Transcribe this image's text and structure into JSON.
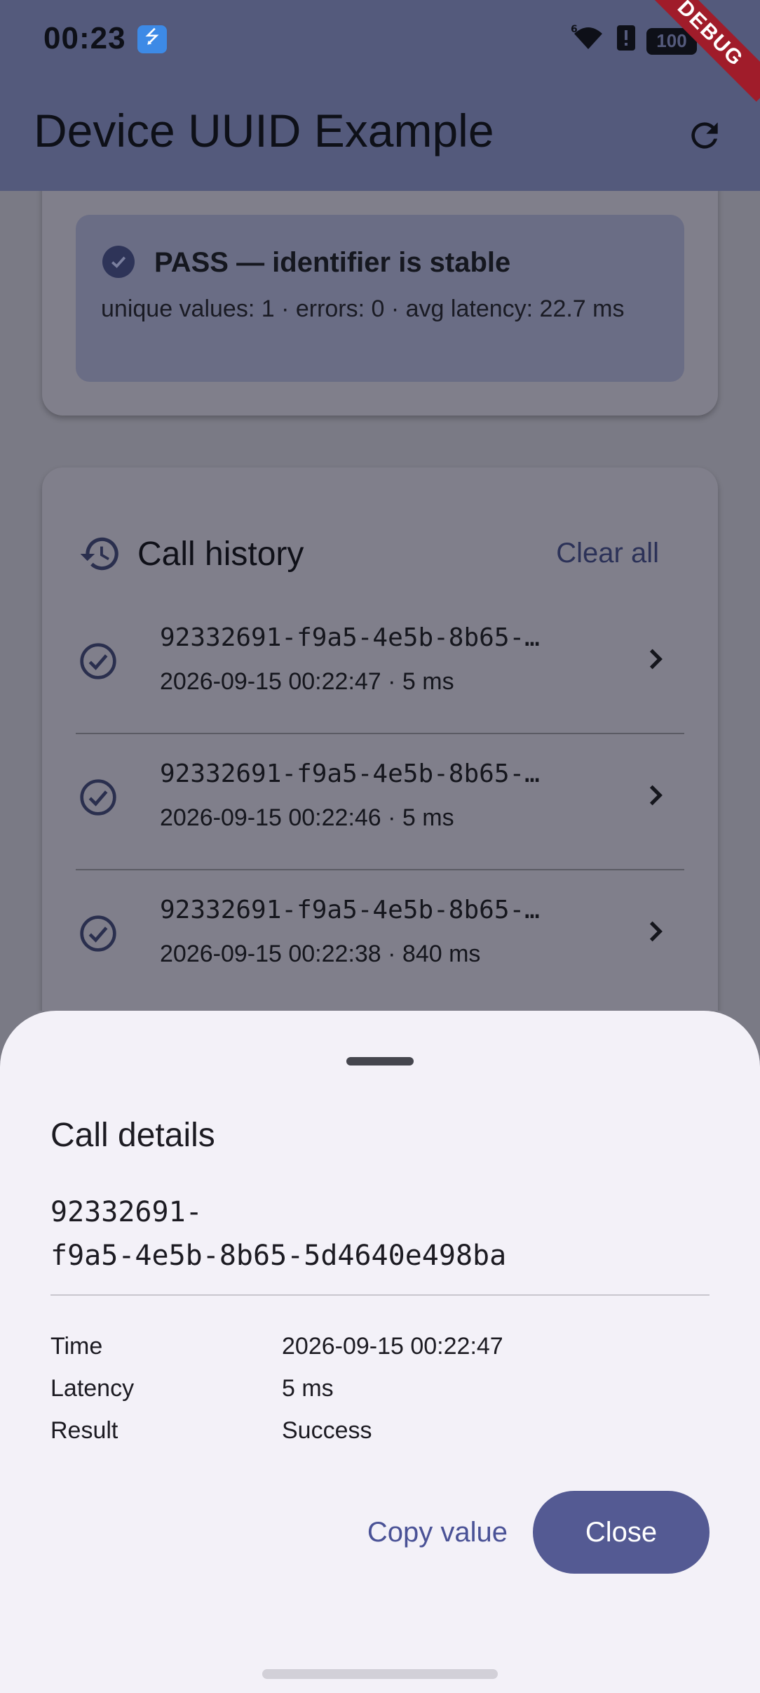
{
  "status_bar": {
    "time": "00:23",
    "battery": "100",
    "signal_label": "6",
    "icons": [
      "usb-icon",
      "wifi-icon",
      "alert-icon",
      "battery-icon"
    ]
  },
  "app_bar": {
    "title": "Device UUID Example",
    "refresh_icon": "refresh-icon",
    "debug_banner": "DEBUG"
  },
  "summary_card": {
    "status_title": "PASS — identifier is stable",
    "stats": "unique values: 1 · errors: 0 · avg latency: 22.7 ms"
  },
  "history": {
    "title": "Call history",
    "clear_label": "Clear all",
    "items": [
      {
        "id": "92332691-f9a5-4e5b-8b65-…",
        "meta": "2026-09-15 00:22:47 · 5 ms"
      },
      {
        "id": "92332691-f9a5-4e5b-8b65-…",
        "meta": "2026-09-15 00:22:46 · 5 ms"
      },
      {
        "id": "92332691-f9a5-4e5b-8b65-…",
        "meta": "2026-09-15 00:22:38 · 840 ms"
      }
    ]
  },
  "sheet": {
    "title": "Call details",
    "value_line1": "92332691-",
    "value_line2": "f9a5-4e5b-8b65-5d4640e498ba",
    "details": [
      {
        "key": "Time",
        "value": "2026-09-15 00:22:47"
      },
      {
        "key": "Latency",
        "value": "5 ms"
      },
      {
        "key": "Result",
        "value": "Success"
      }
    ],
    "copy_label": "Copy value",
    "close_label": "Close"
  },
  "colors": {
    "app_bar": "#545a7c",
    "primary": "#545a93",
    "sheet_bg": "#f3f1f8"
  }
}
